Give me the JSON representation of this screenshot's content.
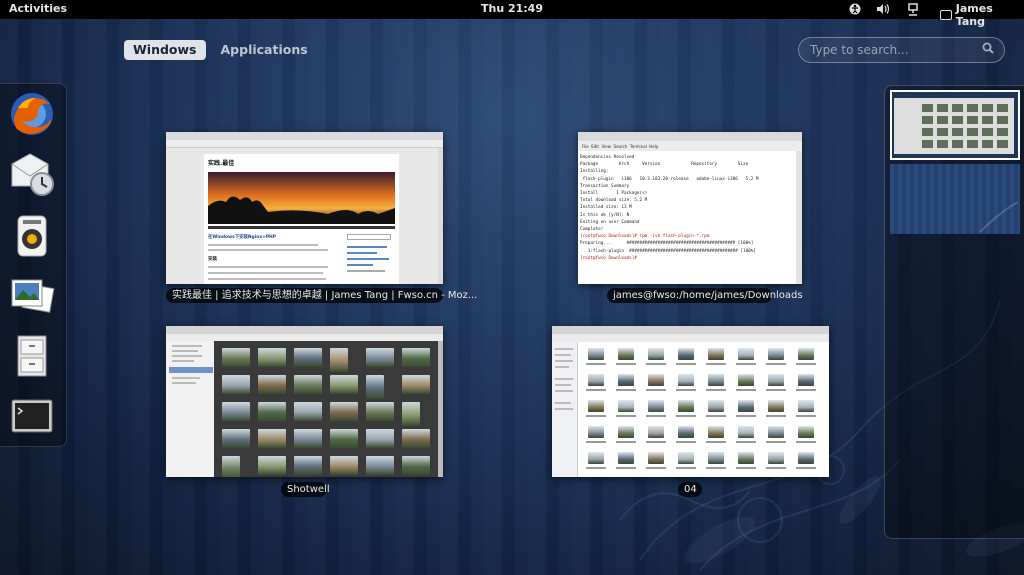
{
  "topbar": {
    "activities": "Activities",
    "clock": "Thu 21:49",
    "user": "James Tang",
    "tray_icons": [
      "accessibility-icon",
      "volume-icon",
      "network-icon",
      "user-chat-icon"
    ]
  },
  "overview": {
    "tabs": [
      {
        "label": "Windows",
        "active": true
      },
      {
        "label": "Applications",
        "active": false
      }
    ],
    "search_placeholder": "Type to search..."
  },
  "dash": {
    "apps": [
      "firefox-icon",
      "mail-clock-icon",
      "audio-player-icon",
      "photos-icon",
      "file-cabinet-icon",
      "terminal-icon"
    ]
  },
  "windows": [
    {
      "caption": "实践最佳 | 追求技术与思想的卓越 | James Tang | Fwso.cn - Moz...",
      "content": {
        "heading": "实践.最佳",
        "post_title": "在Windows下安装Nginx+PHP",
        "section": "安装"
      }
    },
    {
      "caption": "james@fwso:/home/james/Downloads",
      "content": {
        "lines": [
          "Dependencies Resolved",
          "Package        Arch     Version            Repository        Size",
          "Installing:",
          " flash-plugin   i386   10.3.183.20-release   adobe-linux-i386   5.2 M",
          "Transaction Summary",
          "Install       1 Package(s)",
          "Total download size: 5.2 M",
          "Installed size: 13 M",
          "Is this ok [y/N]: N",
          "Exiting on user Command",
          "Complete!",
          "[root@fwso Downloads]# rpm -ivh flash-plugin-*.rpm",
          "Preparing...      ########################################## [100%]",
          "   1:flash-plugin  ########################################## [100%]",
          "[root@fwso Downloads]# "
        ]
      }
    },
    {
      "caption": "Shotwell",
      "content": {}
    },
    {
      "caption": "04",
      "content": {}
    }
  ],
  "colors": {
    "accent": "#dfe3ea",
    "topbar": "#000000",
    "bg": "#1b3258"
  }
}
